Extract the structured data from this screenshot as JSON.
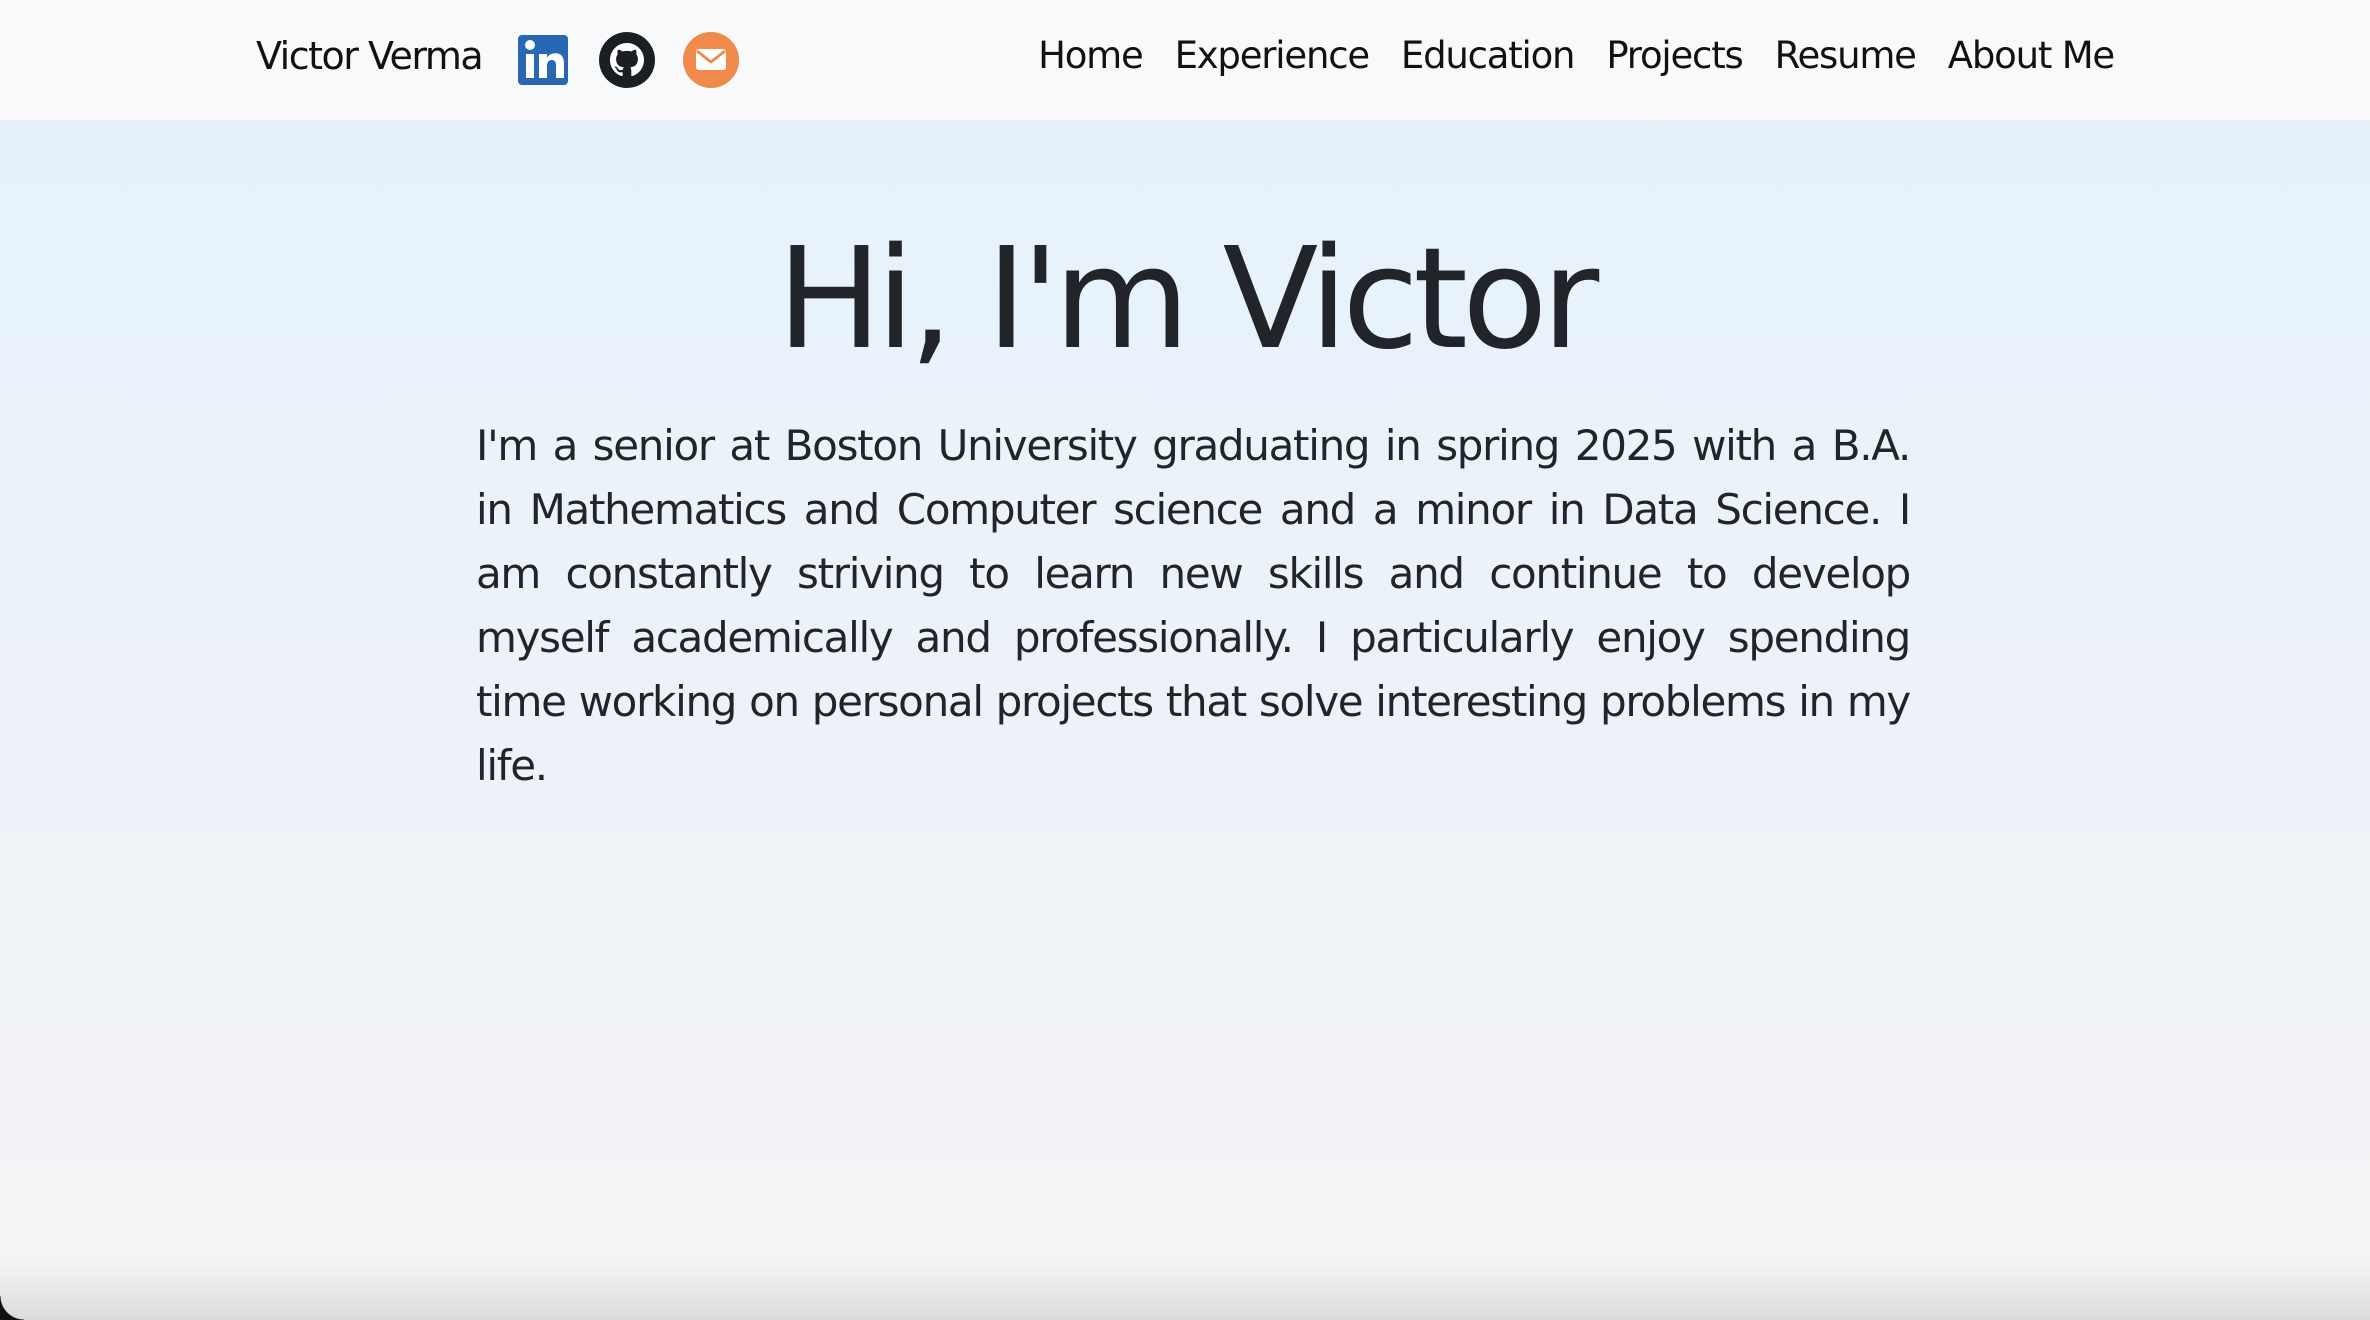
{
  "navbar": {
    "brand": "Victor Verma",
    "social": [
      {
        "icon": "linkedin-icon",
        "color": "#2867b2"
      },
      {
        "icon": "github-icon",
        "color": "#1b1f23"
      },
      {
        "icon": "email-icon",
        "color": "#ef8a4a"
      }
    ],
    "links": [
      {
        "label": "Home"
      },
      {
        "label": "Experience"
      },
      {
        "label": "Education"
      },
      {
        "label": "Projects"
      },
      {
        "label": "Resume"
      },
      {
        "label": "About Me"
      }
    ]
  },
  "hero": {
    "title": "Hi, I'm Victor",
    "intro": "I'm a senior at Boston University graduating in spring 2025 with a B.A. in Mathematics and Computer science and a minor in Data Science. I am constantly striving to learn new skills and continue to develop myself academically and professionally. I particularly enjoy spending time working on personal projects that solve interesting problems in my life."
  }
}
